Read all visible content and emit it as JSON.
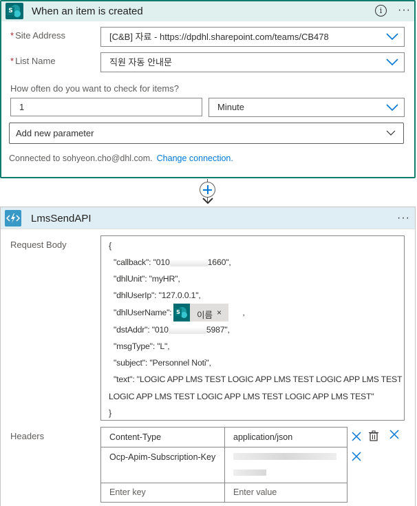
{
  "trigger": {
    "title": "When an item is created",
    "site_address_label": "Site Address",
    "site_address_value": "[C&B] 자료 - https://dpdhl.sharepoint.com/teams/CB478",
    "list_name_label": "List Name",
    "list_name_value": "직원 자동 안내문",
    "frequency_label": "How often do you want to check for items?",
    "interval_value": "1",
    "frequency_value": "Minute",
    "add_param_label": "Add new parameter",
    "connected_text": "Connected to sohyeon.cho@dhl.com.",
    "change_connection": "Change connection.",
    "required_mark": "*",
    "info_glyph": "i",
    "more_glyph": "···"
  },
  "action": {
    "title": "LmsSendAPI",
    "more_glyph": "···",
    "request_body_label": "Request Body",
    "headers_label": "Headers",
    "body_lines": {
      "open": "{",
      "callback": "\"callback\": \"010",
      "callback_tail": "1660\",",
      "dhlUnit": "\"dhlUnit\": \"myHR\",",
      "dhlUserIp": "\"dhlUserIp\": \"127.0.0.1\",",
      "dhlUserName": "\"dhlUserName\":",
      "dhlUserName_tail": ",",
      "dstAddr": "\"dstAddr\": \"010",
      "dstAddr_tail": "5987\",",
      "msgType": "\"msgType\": \"L\",",
      "subject": "\"subject\": \"Personnel Noti\",",
      "text1": "\"text\": \"LOGIC APP LMS TEST LOGIC APP LMS TEST LOGIC APP LMS TEST",
      "text2": "LOGIC APP LMS TEST LOGIC APP LMS TEST LOGIC APP LMS TEST\"",
      "close": "}"
    },
    "token": {
      "label": "이름",
      "close": "×"
    },
    "headers": [
      {
        "key": "Content-Type",
        "value": "application/json"
      },
      {
        "key": "Ocp-Apim-Subscription-Key",
        "value": ""
      }
    ],
    "key_placeholder": "Enter key",
    "value_placeholder": "Enter value"
  },
  "icons": {
    "sharepoint": "sharepoint-icon",
    "api": "api-connector-icon",
    "info": "info-icon",
    "more": "more-icon",
    "chevron": "chevron-down-icon",
    "plus": "plus-icon",
    "close": "close-icon",
    "trash": "trash-icon"
  },
  "colors": {
    "accent": "#107c6e",
    "link": "#0078d4",
    "trigger_header": "#dff0ef",
    "action_header": "#dfeef4"
  }
}
